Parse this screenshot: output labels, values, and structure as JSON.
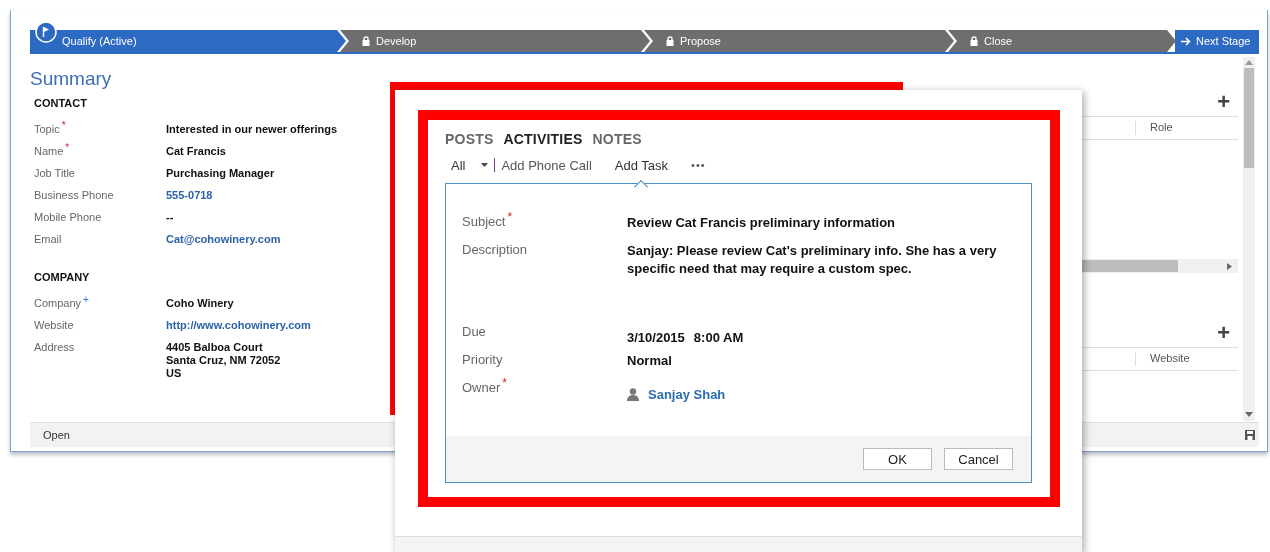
{
  "stages": [
    {
      "label": "Qualify (Active)",
      "selected": true,
      "locked": false
    },
    {
      "label": "Develop",
      "selected": false,
      "locked": true
    },
    {
      "label": "Propose",
      "selected": false,
      "locked": true
    },
    {
      "label": "Close",
      "selected": false,
      "locked": true
    }
  ],
  "next_stage_button": "Next Stage",
  "summary": {
    "title": "Summary",
    "sections": [
      {
        "heading": "CONTACT",
        "fields": [
          {
            "label": "Topic",
            "marker": "*",
            "required": true,
            "value": "Interested in our newer offerings",
            "kind": "text"
          },
          {
            "label": "Name",
            "marker": "*",
            "required": true,
            "value": "Cat Francis",
            "kind": "text"
          },
          {
            "label": "Job Title",
            "value": "Purchasing Manager",
            "kind": "text"
          },
          {
            "label": "Business Phone",
            "value": "555-0718",
            "kind": "link"
          },
          {
            "label": "Mobile Phone",
            "value": "--",
            "kind": "text"
          },
          {
            "label": "Email",
            "value": "Cat@cohowinery.com",
            "kind": "link"
          }
        ]
      },
      {
        "heading": "COMPANY",
        "fields": [
          {
            "label": "Company",
            "marker": "+",
            "required": false,
            "value": "Coho Winery",
            "kind": "text"
          },
          {
            "label": "Website",
            "value": "http://www.cohowinery.com",
            "kind": "link"
          },
          {
            "label": "Address",
            "value": "4405 Balboa Court\nSanta Cruz, NM 72052\nUS",
            "kind": "text"
          }
        ]
      }
    ]
  },
  "side_grids": [
    {
      "add_button": "+",
      "column": "Role"
    },
    {
      "add_button": "+",
      "column": "Website"
    }
  ],
  "footer": {
    "status": "Open"
  },
  "popup": {
    "tabs": [
      {
        "label": "POSTS",
        "selected": false
      },
      {
        "label": "ACTIVITIES",
        "selected": true
      },
      {
        "label": "NOTES",
        "selected": false
      }
    ],
    "filter": "All",
    "actions": [
      {
        "label": "Add Phone Call",
        "selected": false
      },
      {
        "label": "Add Task",
        "selected": true
      }
    ],
    "more": "•••",
    "fields": [
      {
        "label": "Subject",
        "marker": "*",
        "required": true,
        "kind": "text",
        "value": "Review Cat Francis preliminary information"
      },
      {
        "label": "Description",
        "kind": "text",
        "value": "Sanjay: Please review Cat's preliminary info. She has a very specific need that may require a custom spec."
      },
      {
        "label": "Due",
        "kind": "datetime",
        "date": "3/10/2015",
        "time": "8:00 AM"
      },
      {
        "label": "Priority",
        "kind": "text",
        "value": "Normal"
      },
      {
        "label": "Owner",
        "marker": "*",
        "required": true,
        "kind": "person",
        "value": "Sanjay Shah"
      }
    ],
    "buttons": [
      "OK",
      "Cancel"
    ]
  }
}
